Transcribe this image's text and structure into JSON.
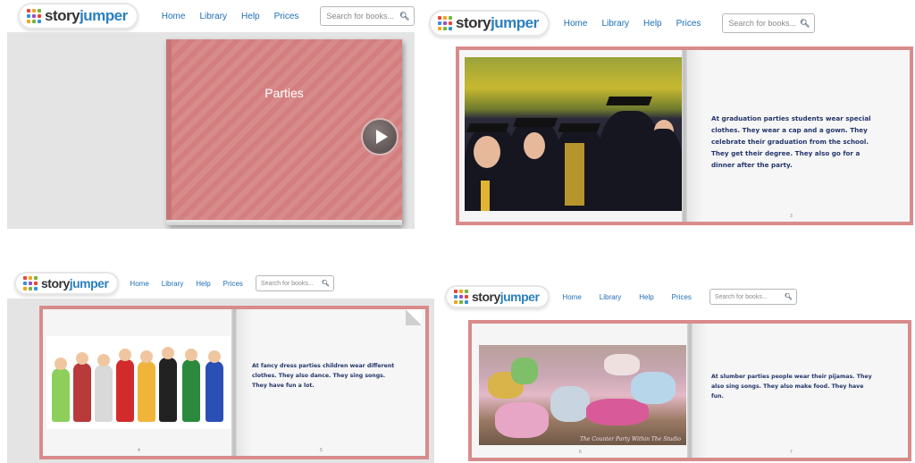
{
  "header": {
    "brand_story": "story",
    "brand_jumper": "jumper",
    "nav": [
      "Home",
      "Library",
      "Help",
      "Prices"
    ],
    "search_placeholder": "Search for books..."
  },
  "cover": {
    "title": "Parties"
  },
  "pages": [
    {
      "photo": "graduation-photo",
      "text": "At graduation parties students wear special clothes. They wear a cap and a gown. They celebrate their graduation from the school. They get their degree. They also go for a dinner after the party.",
      "page_num": "3"
    },
    {
      "photo": "fancy-dress-photo",
      "text": "At fancy dress parties children wear different clothes. They also dance. They sing songs. They have fun a lot.",
      "page_num_left": "4",
      "page_num_right": "5"
    },
    {
      "photo": "slumber-party-photo",
      "text": "At slumber parties people wear their pijamas. They also sing songs. They also make food. They have fun.",
      "page_num_left": "6",
      "page_num_right": "7",
      "photo_caption": "The Counter Party Within The Studio"
    }
  ],
  "colors": {
    "book_pink": "#d88b8b",
    "nav_blue": "#1e6fb5",
    "page_text": "#23356b"
  }
}
